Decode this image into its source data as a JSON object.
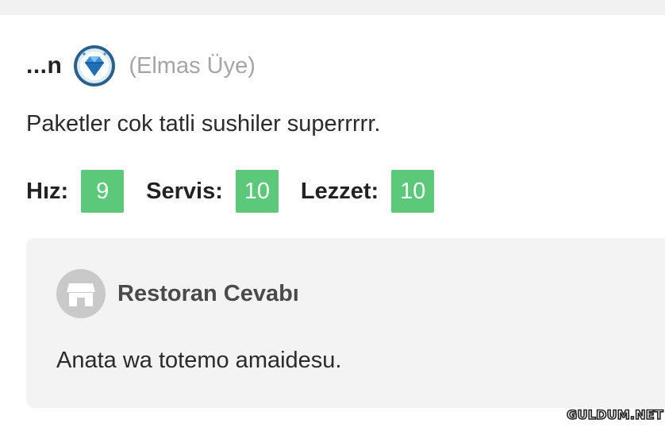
{
  "review": {
    "user_name": "...n",
    "badge_icon": "diamond-icon",
    "member_type": "(Elmas Üye)",
    "comment": "Paketler cok tatli sushiler superrrrr.",
    "ratings": [
      {
        "label": "Hız:",
        "score": "9"
      },
      {
        "label": "Servis:",
        "score": "10"
      },
      {
        "label": "Lezzet:",
        "score": "10"
      }
    ],
    "score_color": "#5cc97a"
  },
  "reply": {
    "icon": "store-icon",
    "title": "Restoran Cevabı",
    "text": "Anata wa totemo amaidesu."
  },
  "watermark": "GULDUM.NET"
}
